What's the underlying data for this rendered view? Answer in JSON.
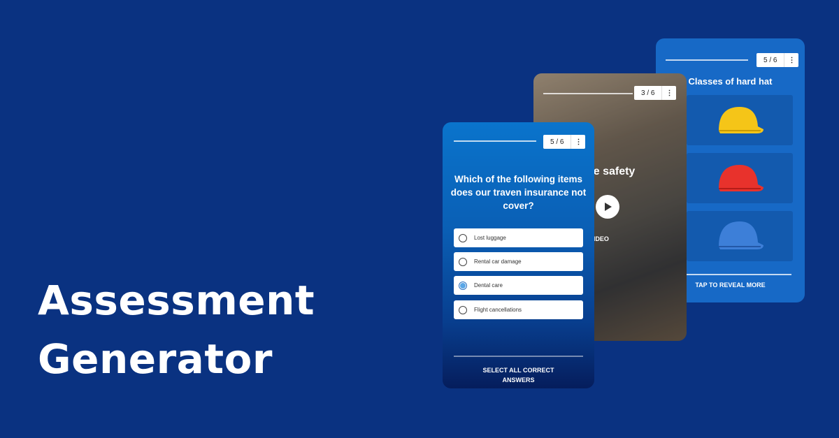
{
  "hero": {
    "line1": "Assessment",
    "line2": "Generator"
  },
  "colors": {
    "background": "#0a3281",
    "card_accent": "#1769c6",
    "selected_radio": "#5aa6e6"
  },
  "card_hardhat": {
    "counter": "5 / 6",
    "menu_icon": "more-vertical-icon",
    "title": "Classes of hard hat",
    "hats": [
      "yellow",
      "red",
      "blue"
    ],
    "footer": "TAP TO REVEAL MORE"
  },
  "card_video": {
    "counter": "3 / 6",
    "title": "Workplace safety",
    "watch": "WATCH VIDEO",
    "icon": "play-icon"
  },
  "card_quiz": {
    "counter": "5 / 6",
    "question": "Which of the following items does our traven insurance not cover?",
    "options": [
      {
        "label": "Lost luggage",
        "selected": false
      },
      {
        "label": "Rental car damage",
        "selected": false
      },
      {
        "label": "Dental care",
        "selected": true
      },
      {
        "label": "Flight cancellations",
        "selected": false
      }
    ],
    "footer": "SELECT ALL CORRECT ANSWERS"
  }
}
